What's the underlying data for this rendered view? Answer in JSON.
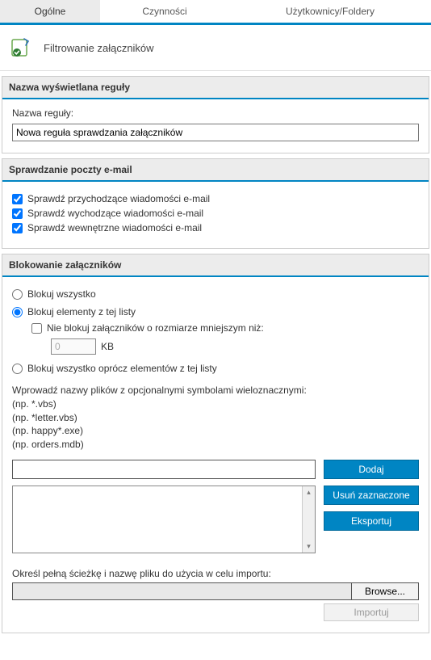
{
  "tabs": {
    "general": "Ogólne",
    "actions": "Czynności",
    "users_folders": "Użytkownicy/Foldery"
  },
  "page_title": "Filtrowanie załączników",
  "section_rule_name": {
    "header": "Nazwa wyświetlana reguły",
    "label": "Nazwa reguły:",
    "value": "Nowa reguła sprawdzania załączników"
  },
  "section_email_check": {
    "header": "Sprawdzanie poczty e-mail",
    "check_incoming": "Sprawdź przychodzące wiadomości e-mail",
    "check_outgoing": "Sprawdź wychodzące wiadomości e-mail",
    "check_internal": "Sprawdź wewnętrzne wiadomości e-mail"
  },
  "section_block": {
    "header": "Blokowanie załączników",
    "radio_all": "Blokuj wszystko",
    "radio_list": "Blokuj elementy z tej listy",
    "sub_size_check": "Nie blokuj załączników o rozmiarze mniejszym niż:",
    "size_value": "0",
    "size_unit": "KB",
    "radio_except": "Blokuj wszystko oprócz elementów z tej listy",
    "hint_intro": "Wprowadź nazwy plików z opcjonalnymi symbolami wieloznacznymi:",
    "hint_ex1": "(np. *.vbs)",
    "hint_ex2": "(np. *letter.vbs)",
    "hint_ex3": "(np. happy*.exe)",
    "hint_ex4": "(np. orders.mdb)",
    "btn_add": "Dodaj",
    "btn_remove": "Usuń zaznaczone",
    "btn_export": "Eksportuj",
    "import_label": "Określ pełną ścieżkę i nazwę pliku do użycia w celu importu:",
    "btn_browse": "Browse...",
    "btn_import": "Importuj"
  }
}
